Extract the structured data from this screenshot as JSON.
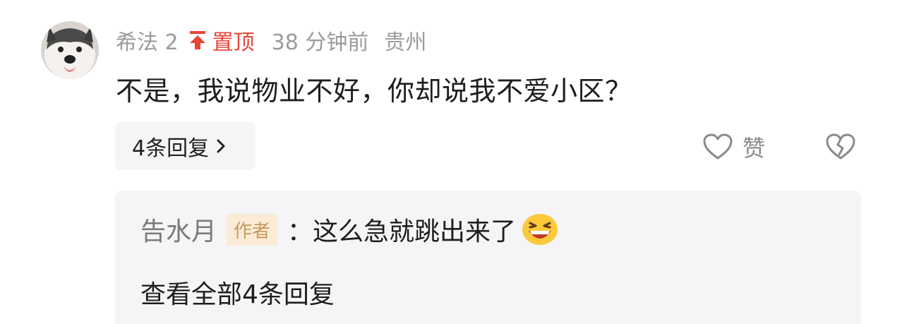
{
  "comment": {
    "username": "希法 2",
    "pin_label": "置顶",
    "time": "38 分钟前",
    "location": "贵州",
    "text": "不是，我说物业不好，你却说我不爱小区？",
    "replies_button_label": "4条回复",
    "like_label": "赞"
  },
  "reply_preview": {
    "author": "告水月",
    "author_badge": "作者",
    "text": "：这么急就跳出来了",
    "view_all_label": "查看全部4条回复"
  },
  "colors": {
    "pin_red": "#e8463b",
    "meta_gray": "#9b9b9b",
    "panel_bg": "#f5f5f7",
    "badge_bg": "#fbebd6",
    "badge_text": "#c79a5c"
  },
  "icons": {
    "avatar": "husky-avatar",
    "pin": "pin-top-icon",
    "chevron": "chevron-right-icon",
    "like": "heart-outline-icon",
    "dislike": "broken-heart-icon",
    "emoji": "laughing-emoji-icon"
  }
}
